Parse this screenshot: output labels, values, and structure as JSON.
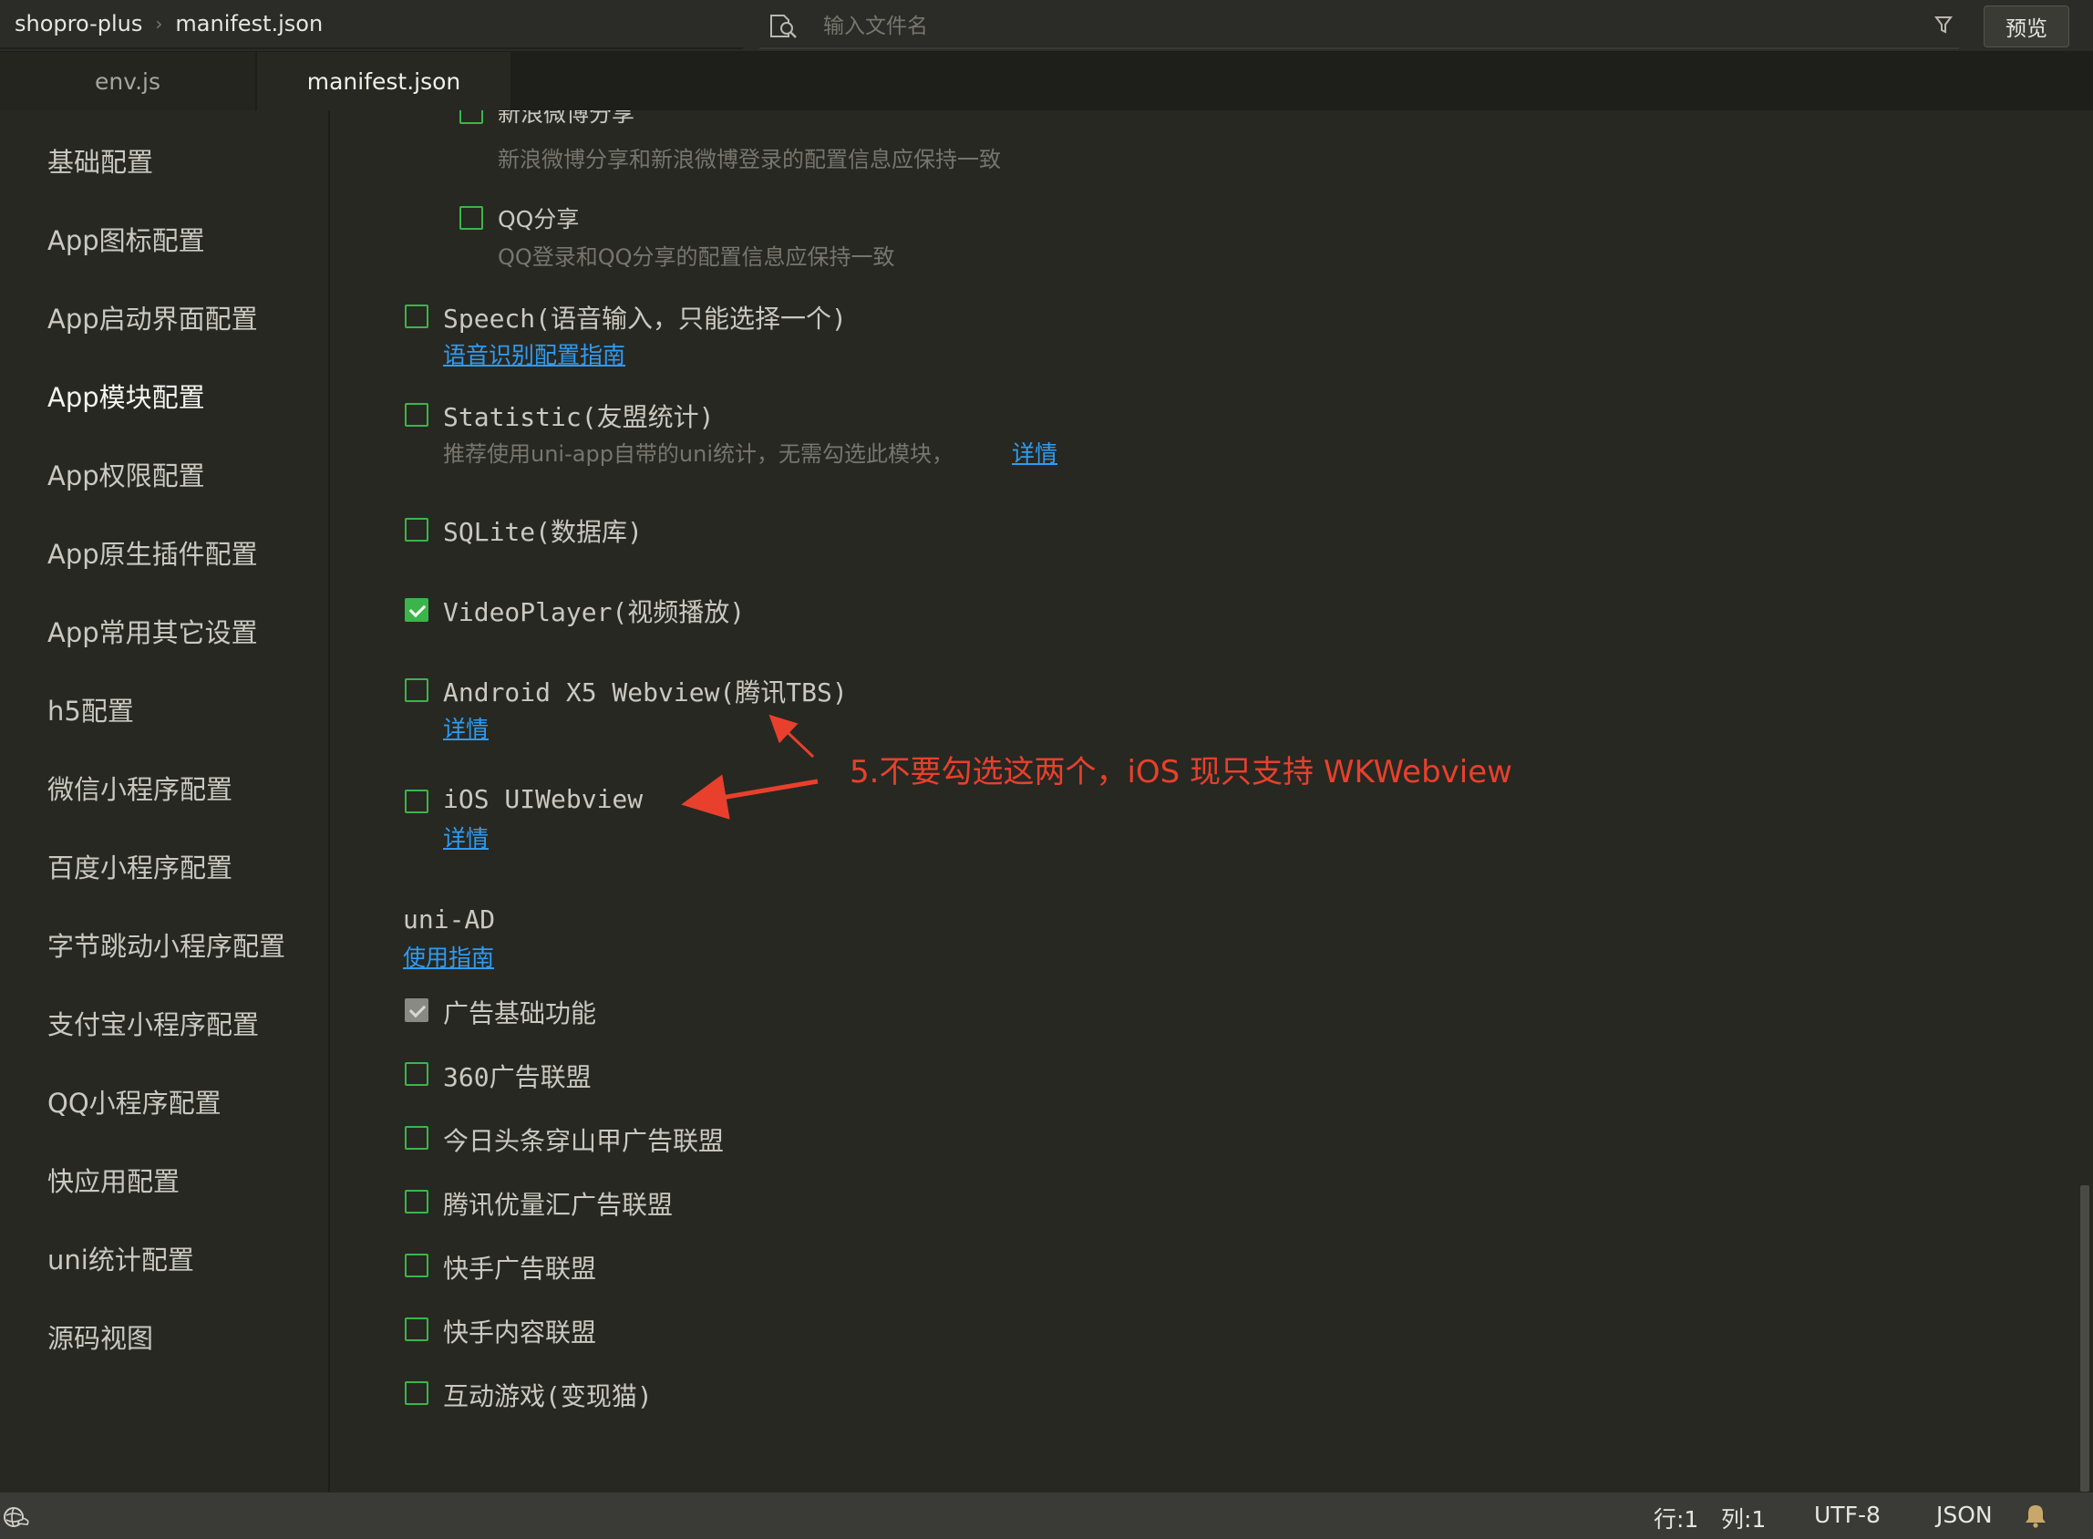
{
  "breadcrumb": {
    "project": "shopro-plus",
    "file": "manifest.json"
  },
  "search": {
    "placeholder": "输入文件名"
  },
  "toolbar": {
    "preview_label": "预览"
  },
  "tabs": [
    {
      "label": "env.js",
      "active": false
    },
    {
      "label": "manifest.json",
      "active": true
    }
  ],
  "sidebar": {
    "items": [
      {
        "label": "基础配置"
      },
      {
        "label": "App图标配置"
      },
      {
        "label": "App启动界面配置"
      },
      {
        "label": "App模块配置",
        "active": true
      },
      {
        "label": "App权限配置"
      },
      {
        "label": "App原生插件配置"
      },
      {
        "label": "App常用其它设置"
      },
      {
        "label": "h5配置"
      },
      {
        "label": "微信小程序配置"
      },
      {
        "label": "百度小程序配置"
      },
      {
        "label": "字节跳动小程序配置"
      },
      {
        "label": "支付宝小程序配置"
      },
      {
        "label": "QQ小程序配置"
      },
      {
        "label": "快应用配置"
      },
      {
        "label": "uni统计配置"
      },
      {
        "label": "源码视图"
      }
    ]
  },
  "modules": {
    "weibo_share": {
      "label": "新浪微博分享",
      "desc": "新浪微博分享和新浪微博登录的配置信息应保持一致",
      "checked": false
    },
    "qq_share": {
      "label": "QQ分享",
      "desc": "QQ登录和QQ分享的配置信息应保持一致",
      "checked": false
    },
    "speech": {
      "label": "Speech(语音输入，只能选择一个)",
      "link": "语音识别配置指南",
      "checked": false
    },
    "statistic": {
      "label": "Statistic(友盟统计)",
      "desc": "推荐使用uni-app自带的uni统计，无需勾选此模块，",
      "link": "详情",
      "checked": false
    },
    "sqlite": {
      "label": "SQLite(数据库)",
      "checked": false
    },
    "videoplayer": {
      "label": "VideoPlayer(视频播放)",
      "checked": true
    },
    "x5webview": {
      "label": "Android X5 Webview(腾讯TBS)",
      "link": "详情",
      "checked": false
    },
    "uiwebview": {
      "label": "iOS UIWebview",
      "link": "详情",
      "checked": false
    }
  },
  "uni_ad": {
    "title": "uni-AD",
    "guide_link": "使用指南",
    "items": [
      {
        "label": "广告基础功能",
        "checked": true,
        "disabled": true
      },
      {
        "label": "360广告联盟",
        "checked": false
      },
      {
        "label": "今日头条穿山甲广告联盟",
        "checked": false
      },
      {
        "label": "腾讯优量汇广告联盟",
        "checked": false
      },
      {
        "label": "快手广告联盟",
        "checked": false
      },
      {
        "label": "快手内容联盟",
        "checked": false
      },
      {
        "label": "互动游戏(变现猫)",
        "checked": false
      }
    ]
  },
  "annotation": {
    "text": "5.不要勾选这两个，iOS 现只支持 WKWebview",
    "color": "#e8402c"
  },
  "status": {
    "row": "行:1",
    "col": "列:1",
    "encoding": "UTF-8",
    "lang": "JSON"
  },
  "colors": {
    "accent": "#3bb54a",
    "link": "#2f9bf2",
    "background": "#272822"
  }
}
